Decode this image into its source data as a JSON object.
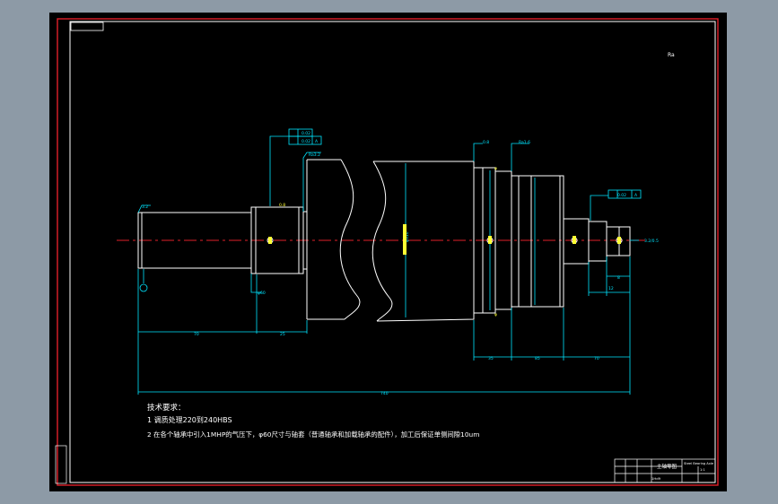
{
  "colors": {
    "background": "#8d9aa6",
    "paper": "#000000",
    "frame": "#e0202a",
    "part": "#ffffff",
    "dimension": "#00e5ff",
    "centerline": "#e0202a",
    "highlight": "#ffff33"
  },
  "top_right_mark": "Ra",
  "tolerance_frames": {
    "upper_row1": "0.02",
    "upper_row2": "0.02",
    "upper_datum": "A",
    "right_value": "0.02",
    "right_datum": "A"
  },
  "surface_marks": {
    "left_end": "3.2",
    "body_top": "Ra3.2",
    "collar_a": "0.8",
    "collar_b": "Ra1.6",
    "collar_c": "0.8",
    "right_end": "3.2/0.5"
  },
  "dimensions": {
    "left_shaft_dia": "φ50",
    "main_body_dia": "φ310",
    "flange_dia": "φ",
    "step_dia": "φ",
    "left_length": "70",
    "neck_length": "25",
    "flange_width": "35",
    "sleeve_length": "85",
    "end_length": "70",
    "right_small_a": "8",
    "right_small_b": "12",
    "overall_length": "740",
    "bottom_tick": "φ60"
  },
  "notes": {
    "heading": "技术要求：",
    "line1": "1 调质处理220到240HBS",
    "line2": "2 在各个轴承中引入1MHP的气压下，φ60尺寸与轴套（普通轴承和加载轴承的配件），加工后保证单侧间隙10um"
  },
  "title_block": {
    "drawing_title": "主轴零图",
    "right_title": "Steel Bearing Axle",
    "part_code": "1:1",
    "row_text": "1Hd9"
  }
}
